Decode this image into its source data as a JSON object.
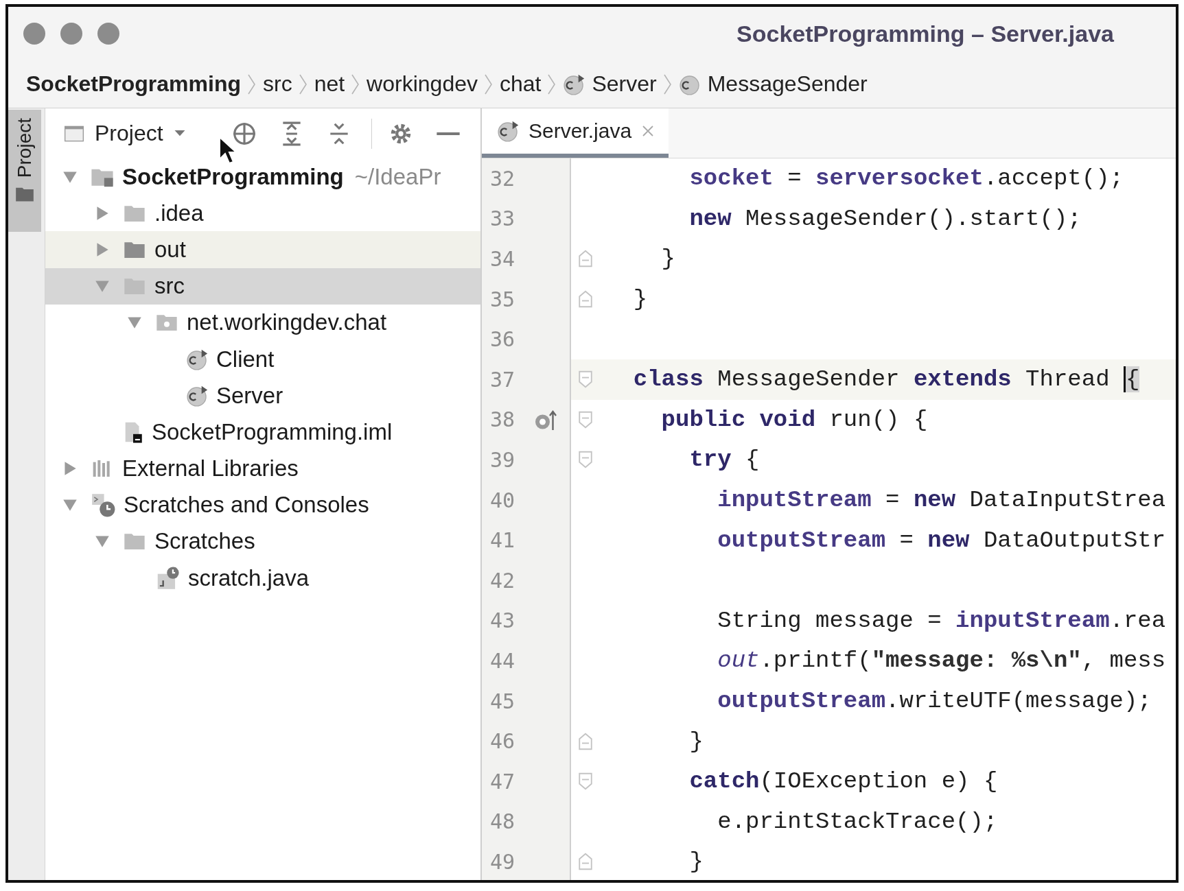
{
  "window": {
    "title": "SocketProgramming – Server.java"
  },
  "breadcrumbs": [
    {
      "label": "SocketProgramming",
      "kind": "project"
    },
    {
      "label": "src",
      "kind": "folder"
    },
    {
      "label": "net",
      "kind": "folder"
    },
    {
      "label": "workingdev",
      "kind": "folder"
    },
    {
      "label": "chat",
      "kind": "folder"
    },
    {
      "label": "Server",
      "kind": "runnable_class"
    },
    {
      "label": "MessageSender",
      "kind": "class"
    }
  ],
  "side_stripe": {
    "label": "Project",
    "selected": true
  },
  "project_panel": {
    "view": "Project",
    "tree": [
      {
        "label": "SocketProgramming",
        "hint": "~/IdeaPr",
        "kind": "module",
        "expanded": true,
        "selected": false,
        "hovered": false,
        "children": [
          {
            "label": ".idea",
            "kind": "folder",
            "expanded": false,
            "selected": false,
            "hovered": false
          },
          {
            "label": "out",
            "kind": "folder_dark",
            "expanded": false,
            "selected": false,
            "hovered": true
          },
          {
            "label": "src",
            "kind": "folder",
            "expanded": true,
            "selected": true,
            "hovered": false,
            "children": [
              {
                "label": "net.workingdev.chat",
                "kind": "package",
                "expanded": true,
                "selected": false,
                "hovered": false,
                "children": [
                  {
                    "label": "Client",
                    "kind": "runnable_class",
                    "selected": false,
                    "hovered": false
                  },
                  {
                    "label": "Server",
                    "kind": "runnable_class",
                    "selected": false,
                    "hovered": false
                  }
                ]
              }
            ]
          },
          {
            "label": "SocketProgramming.iml",
            "kind": "iml",
            "selected": false,
            "hovered": false
          }
        ]
      },
      {
        "label": "External Libraries",
        "kind": "library",
        "expanded": false,
        "selected": false,
        "hovered": false
      },
      {
        "label": "Scratches and Consoles",
        "kind": "scratches",
        "expanded": true,
        "selected": false,
        "hovered": false,
        "children": [
          {
            "label": "Scratches",
            "kind": "folder",
            "expanded": true,
            "selected": false,
            "hovered": false,
            "children": [
              {
                "label": "scratch.java",
                "kind": "scratch_file",
                "selected": false,
                "hovered": false
              }
            ]
          }
        ]
      }
    ]
  },
  "editor": {
    "tabs": [
      {
        "label": "Server.java",
        "selected": true
      }
    ],
    "lines": [
      {
        "number": "32",
        "fold_start": false,
        "fold_end": false,
        "overrides": false,
        "tokens": [
          {
            "text": "      socket",
            "kind": "field"
          },
          {
            "text": " = ",
            "kind": "plain"
          },
          {
            "text": "serversocket",
            "kind": "field"
          },
          {
            "text": ".accept();",
            "kind": "plain"
          }
        ]
      },
      {
        "number": "33",
        "fold_start": false,
        "fold_end": false,
        "overrides": false,
        "tokens": [
          {
            "text": "      new",
            "kind": "keyword"
          },
          {
            "text": " MessageSender().start();",
            "kind": "plain"
          }
        ]
      },
      {
        "number": "34",
        "fold_start": false,
        "fold_end": true,
        "overrides": false,
        "tokens": [
          {
            "text": "    }",
            "kind": "plain"
          }
        ]
      },
      {
        "number": "35",
        "fold_start": false,
        "fold_end": true,
        "overrides": false,
        "tokens": [
          {
            "text": "  }",
            "kind": "plain"
          }
        ]
      },
      {
        "number": "36",
        "fold_start": false,
        "fold_end": false,
        "overrides": false
      },
      {
        "number": "37",
        "fold_start": true,
        "fold_end": false,
        "overrides": false,
        "current": true,
        "tokens": [
          {
            "text": "  class",
            "kind": "keyword"
          },
          {
            "text": " MessageSender ",
            "kind": "plain"
          },
          {
            "text": "extends",
            "kind": "keyword"
          },
          {
            "text": " Thread ",
            "kind": "plain"
          },
          {
            "text": "{",
            "kind": "brace_match"
          }
        ]
      },
      {
        "number": "38",
        "fold_start": true,
        "fold_end": false,
        "overrides": true,
        "tokens": [
          {
            "text": "    public void",
            "kind": "keyword"
          },
          {
            "text": " run() {",
            "kind": "plain"
          }
        ]
      },
      {
        "number": "39",
        "fold_start": true,
        "fold_end": false,
        "overrides": false,
        "tokens": [
          {
            "text": "      try",
            "kind": "keyword"
          },
          {
            "text": " {",
            "kind": "plain"
          }
        ]
      },
      {
        "number": "40",
        "fold_start": false,
        "fold_end": false,
        "overrides": false,
        "tokens": [
          {
            "text": "        inputStream",
            "kind": "field"
          },
          {
            "text": " = ",
            "kind": "plain"
          },
          {
            "text": "new",
            "kind": "keyword"
          },
          {
            "text": " DataInputStrea",
            "kind": "plain"
          }
        ]
      },
      {
        "number": "41",
        "fold_start": false,
        "fold_end": false,
        "overrides": false,
        "tokens": [
          {
            "text": "        outputStream",
            "kind": "field"
          },
          {
            "text": " = ",
            "kind": "plain"
          },
          {
            "text": "new",
            "kind": "keyword"
          },
          {
            "text": " DataOutputStr",
            "kind": "plain"
          }
        ]
      },
      {
        "number": "42",
        "fold_start": false,
        "fold_end": false,
        "overrides": false
      },
      {
        "number": "43",
        "fold_start": false,
        "fold_end": false,
        "overrides": false,
        "tokens": [
          {
            "text": "        String message = ",
            "kind": "plain"
          },
          {
            "text": "inputStream",
            "kind": "field"
          },
          {
            "text": ".rea",
            "kind": "plain"
          }
        ]
      },
      {
        "number": "44",
        "fold_start": false,
        "fold_end": false,
        "overrides": false,
        "tokens": [
          {
            "text": "        out",
            "kind": "static"
          },
          {
            "text": ".printf(",
            "kind": "plain"
          },
          {
            "text": "\"message: %s\\n\"",
            "kind": "string"
          },
          {
            "text": ", mess",
            "kind": "plain"
          }
        ]
      },
      {
        "number": "45",
        "fold_start": false,
        "fold_end": false,
        "overrides": false,
        "tokens": [
          {
            "text": "        outputStream",
            "kind": "field"
          },
          {
            "text": ".writeUTF(message);",
            "kind": "plain"
          }
        ]
      },
      {
        "number": "46",
        "fold_start": false,
        "fold_end": true,
        "overrides": false,
        "tokens": [
          {
            "text": "      }",
            "kind": "plain"
          }
        ]
      },
      {
        "number": "47",
        "fold_start": true,
        "fold_end": false,
        "overrides": false,
        "tokens": [
          {
            "text": "      catch",
            "kind": "keyword"
          },
          {
            "text": "(IOException e) {",
            "kind": "plain"
          }
        ]
      },
      {
        "number": "48",
        "fold_start": false,
        "fold_end": false,
        "overrides": false,
        "tokens": [
          {
            "text": "        e.printStackTrace();",
            "kind": "plain"
          }
        ]
      },
      {
        "number": "49",
        "fold_start": false,
        "fold_end": true,
        "overrides": false,
        "tokens": [
          {
            "text": "      }",
            "kind": "plain"
          }
        ]
      }
    ]
  }
}
